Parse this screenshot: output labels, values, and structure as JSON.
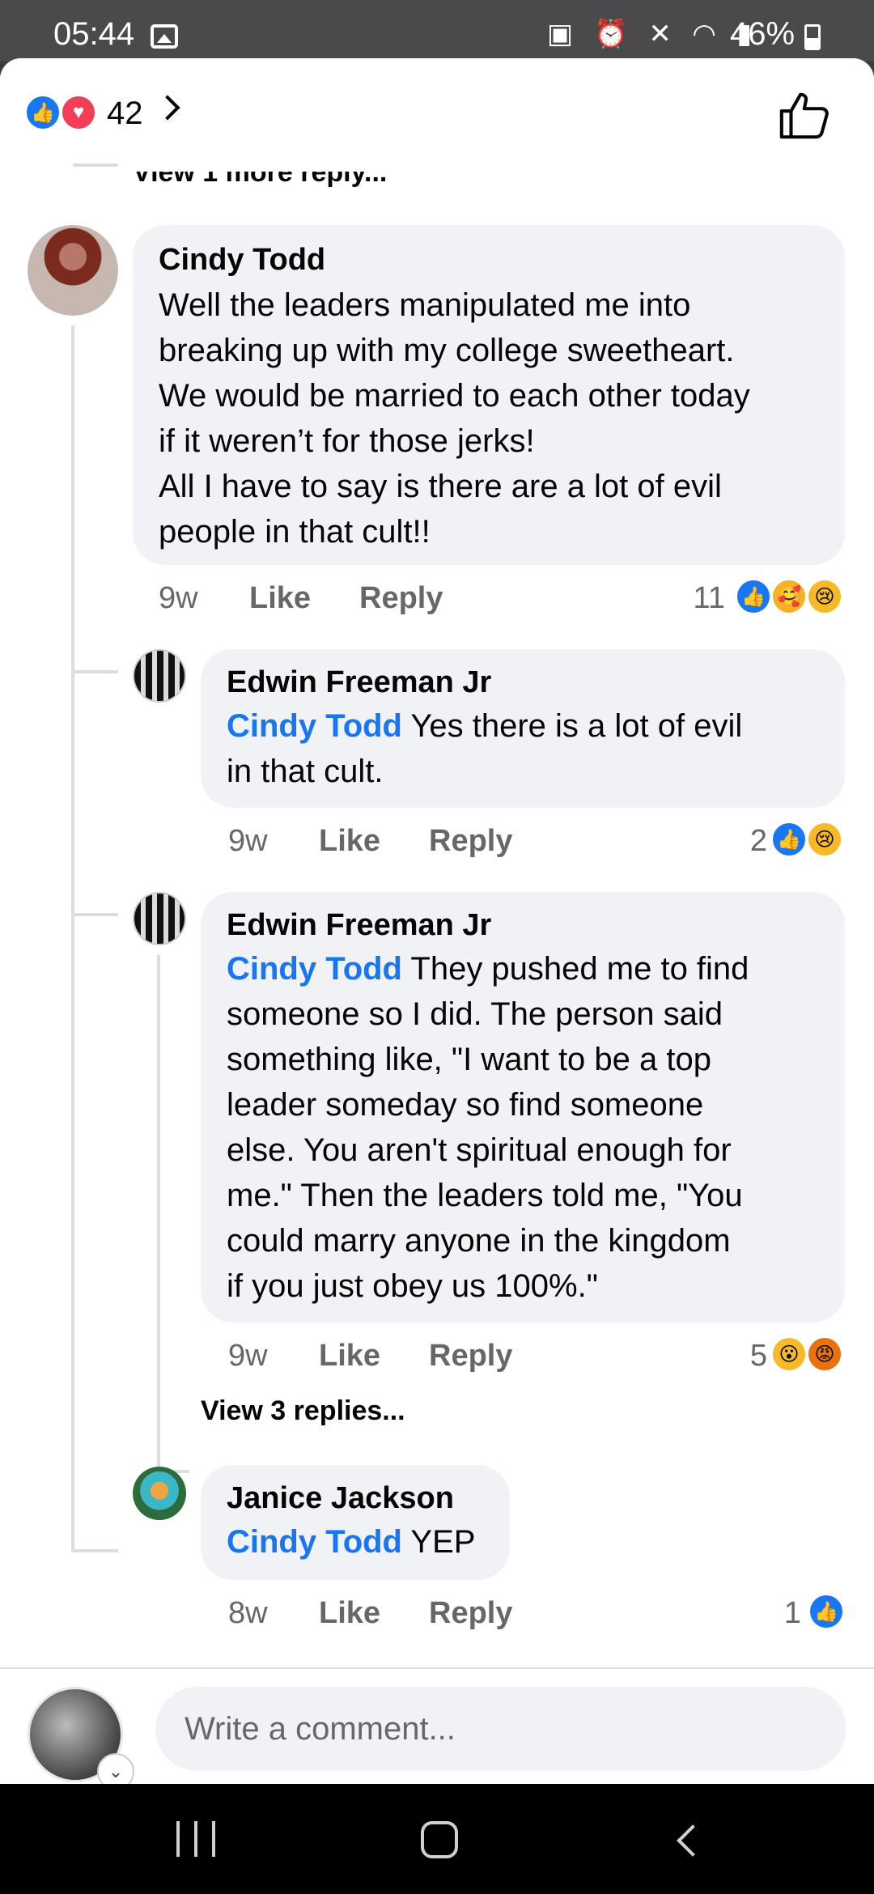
{
  "status": {
    "time": "05:44",
    "icons": "▣ ⏰ ✕ ◠ ▮",
    "battery": "46%"
  },
  "header": {
    "reaction_count": "42",
    "like_icon": "thumbs-up-outline-icon"
  },
  "thread": {
    "view_more_top": "View 1 more reply...",
    "root": {
      "author": "Cindy Todd",
      "lines": [
        "Well the leaders manipulated me into",
        "breaking up with my college sweetheart.",
        "We would be married to each other today",
        "if it weren’t for those jerks!",
        "All I have to say is there are a lot of evil",
        "people in that cult!!"
      ],
      "time": "9w",
      "like": "Like",
      "reply": "Reply",
      "reaction_count": "11"
    },
    "replies": [
      {
        "author": "Edwin Freeman Jr",
        "mention": "Cindy Todd",
        "first_line": " Yes there is a lot of evil",
        "lines": [
          "in that cult."
        ],
        "time": "9w",
        "like": "Like",
        "reply": "Reply",
        "reaction_count": "2"
      },
      {
        "author": "Edwin Freeman Jr",
        "mention": "Cindy Todd",
        "first_line": " They pushed me to find",
        "lines": [
          "someone so I did.  The person said",
          "something like, \"I want to be a top",
          "leader someday so find someone",
          "else.  You aren't spiritual enough for",
          "me.\"  Then the leaders told me, \"You",
          "could marry anyone in the kingdom",
          "if you just obey us 100%.\""
        ],
        "time": "9w",
        "like": "Like",
        "reply": "Reply",
        "reaction_count": "5",
        "view_replies": "View 3 replies..."
      },
      {
        "author": "Janice Jackson",
        "mention": "Cindy Todd",
        "first_line": " YEP",
        "lines": [],
        "time": "8w",
        "like": "Like",
        "reply": "Reply",
        "reaction_count": "1"
      }
    ]
  },
  "composer": {
    "placeholder": "Write a comment..."
  },
  "colors": {
    "accent": "#1876f2",
    "bubble": "#f0f2f5",
    "muted": "#65676b"
  }
}
